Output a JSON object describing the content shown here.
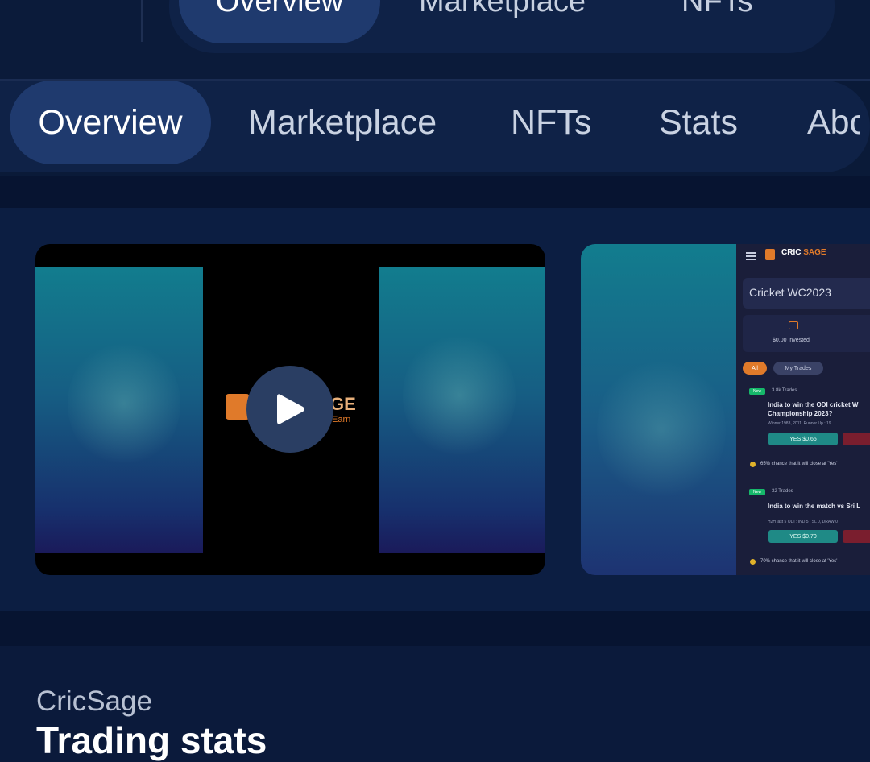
{
  "top_tabs": [
    "Overview",
    "Marketplace",
    "NFTs"
  ],
  "tabs": [
    "Overview",
    "Marketplace",
    "NFTs",
    "Stats",
    "Abc"
  ],
  "video": {
    "logo_text": "GE",
    "logo_subtext": "Earn"
  },
  "screenshot": {
    "brand_cric": "CRIC",
    "brand_sage": "SAGE",
    "title": "Cricket WC2023",
    "invested": "$0.00 Invested",
    "chip_all": "All",
    "chip_mine": "My Trades",
    "cards": [
      {
        "tag": "New",
        "trades": "3.8k Trades",
        "question_line1": "India to win the ODI cricket W",
        "question_line2": "Championship 2023?",
        "meta": "Winner:1983, 2011, Runner Up : 19",
        "yes": "YES $0.65",
        "chance": "65% chance that it will close at 'Yes'"
      },
      {
        "tag": "New",
        "trades": "32 Trades",
        "question_line1": "India to win the match vs Sri L",
        "question_line2": "",
        "meta": "H2H last 5 ODI : IND 5 , SL 0, DRAW 0",
        "yes": "YES $0.70",
        "chance": "70% chance that it will close at 'Yes'"
      }
    ]
  },
  "section": {
    "brand": "CricSage",
    "title": "Trading stats"
  },
  "colors": {
    "background": "#0a1a38",
    "pill_track": "#0f2247",
    "active_tab": "#1f3a6e",
    "accent_orange": "#e07a2a"
  }
}
